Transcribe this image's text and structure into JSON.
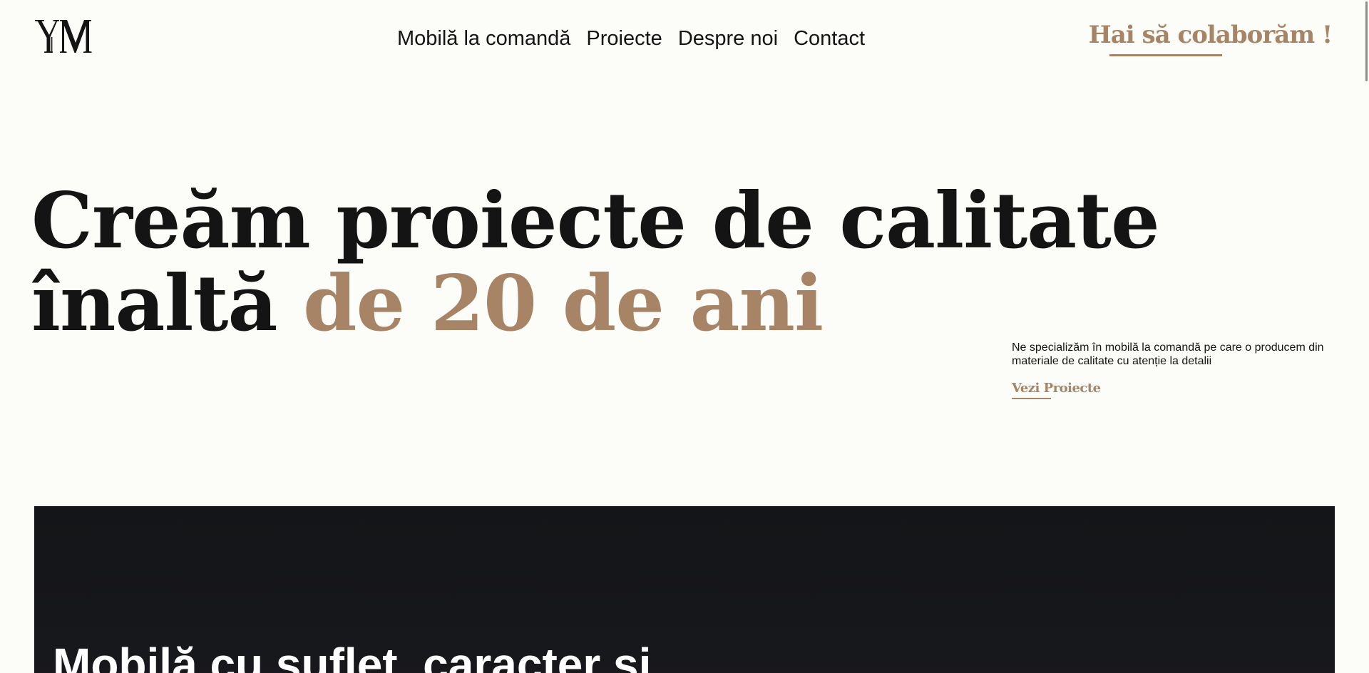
{
  "header": {
    "logo_alt": "YM",
    "nav": [
      {
        "label": "Mobilă la comandă"
      },
      {
        "label": "Proiecte"
      },
      {
        "label": "Despre noi"
      },
      {
        "label": "Contact"
      }
    ],
    "cta_label": "Hai să colaborăm !"
  },
  "hero": {
    "title_line1": "Creăm proiecte de calitate",
    "title_line2_start": "înaltă ",
    "title_line2_accent": "de 20 de ani",
    "description": "Ne specializăm în mobilă la comandă pe care o producem din materiale de calitate cu atenție la detalii",
    "link_label": "Vezi Proiecte"
  },
  "showcase": {
    "title": "Mobilă cu suflet, caracter și"
  },
  "colors": {
    "background": "#fcfdf8",
    "text": "#141414",
    "accent": "#a88466",
    "dark_section": "#141518"
  }
}
